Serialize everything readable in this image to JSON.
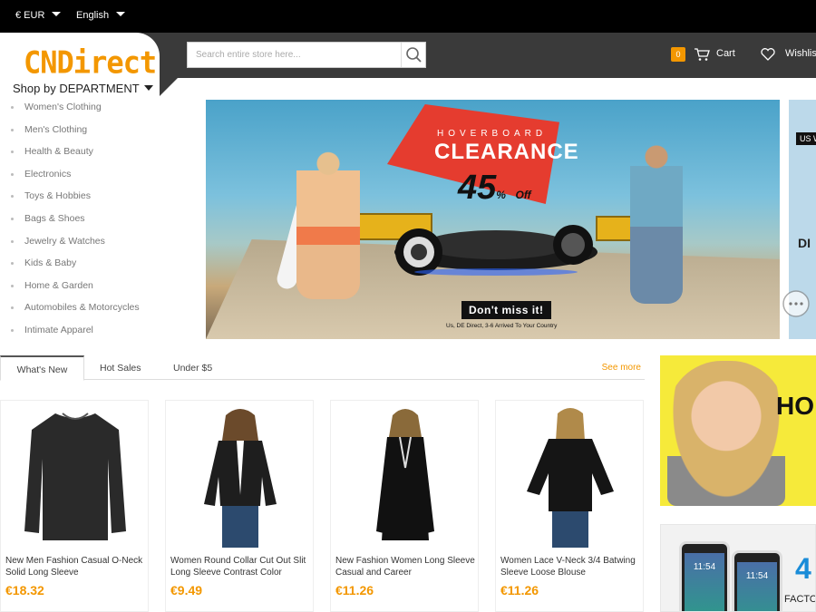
{
  "topbar": {
    "currency": "€ EUR",
    "language": "English"
  },
  "header": {
    "logo": "CNDirect",
    "department_label": "Shop by DEPARTMENT",
    "search_placeholder": "Search entire store here...",
    "cart_count": "0",
    "cart_label": "Cart",
    "wishlist_label": "Wishlis"
  },
  "categories": [
    "Women's Clothing",
    "Men's Clothing",
    "Health & Beauty",
    "Electronics",
    "Toys & Hobbies",
    "Bags & Shoes",
    "Jewelry & Watches",
    "Kids & Baby",
    "Home & Garden",
    "Automobiles & Motorcycles",
    "Intimate Apparel"
  ],
  "banner": {
    "kicker": "HOVERBOARD",
    "headline": "CLEARANCE",
    "discount": "45",
    "discount_suffix": "%",
    "discount_off": "Off",
    "cta": "Don't miss it!",
    "note": "Us, DE Direct, 3-6 Arrived To Your Country"
  },
  "next_slide": {
    "badge": "US W",
    "text": "DI"
  },
  "tabs": {
    "items": [
      "What's New",
      "Hot Sales",
      "Under $5"
    ],
    "see_more": "See more"
  },
  "products": [
    {
      "name": "New Men Fashion Casual O-Neck Solid Long Sleeve",
      "price": "€18.32"
    },
    {
      "name": "Women Round Collar Cut Out Slit Long Sleeve Contrast Color",
      "price": "€9.49"
    },
    {
      "name": "New Fashion Women Long Sleeve Casual and Career",
      "price": "€11.26"
    },
    {
      "name": "Women Lace V-Neck 3/4 Batwing Sleeve Loose Blouse",
      "price": "€11.26"
    }
  ],
  "promos": {
    "hot": "HO",
    "phone_time": "11:54",
    "factory_number": "4",
    "factory_label": "FACTO"
  },
  "colors": {
    "accent": "#f39700",
    "header_bg": "#3a3a3a",
    "topbar_bg": "#000000",
    "banner_flag": "#e53c2f"
  },
  "icons": [
    "caret-down-icon",
    "search-icon",
    "cart-icon",
    "heart-icon",
    "chat-icon"
  ]
}
